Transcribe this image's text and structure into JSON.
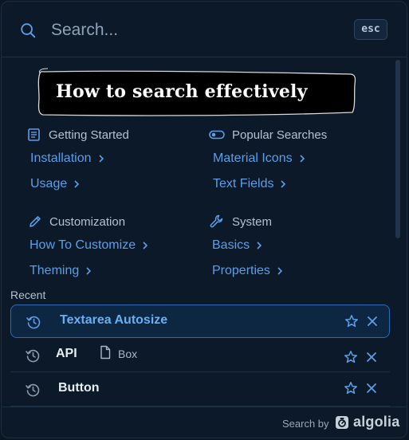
{
  "search": {
    "placeholder": "Search...",
    "esc_label": "esc"
  },
  "banner": {
    "text": "How to search effectively"
  },
  "categories": [
    {
      "title": "Getting Started",
      "icon": "document-list-icon",
      "links": [
        "Installation",
        "Usage"
      ]
    },
    {
      "title": "Popular Searches",
      "icon": "toggle-icon",
      "links": [
        "Material Icons",
        "Text Fields"
      ]
    },
    {
      "title": "Customization",
      "icon": "pencil-icon",
      "links": [
        "How To Customize",
        "Theming"
      ]
    },
    {
      "title": "System",
      "icon": "wrench-icon",
      "links": [
        "Basics",
        "Properties"
      ]
    }
  ],
  "recent": {
    "label": "Recent",
    "items": [
      {
        "title": "Textarea Autosize",
        "active": true
      },
      {
        "title": "API",
        "sub_label": "Box",
        "sub_icon": "document-icon"
      },
      {
        "title": "Button"
      }
    ]
  },
  "footer": {
    "search_by": "Search by",
    "brand": "algolia"
  },
  "colors": {
    "background": "#0b1929",
    "accent_link": "#5d9ee6",
    "active_border": "#2b6bb5",
    "active_bg": "#0d2743"
  }
}
